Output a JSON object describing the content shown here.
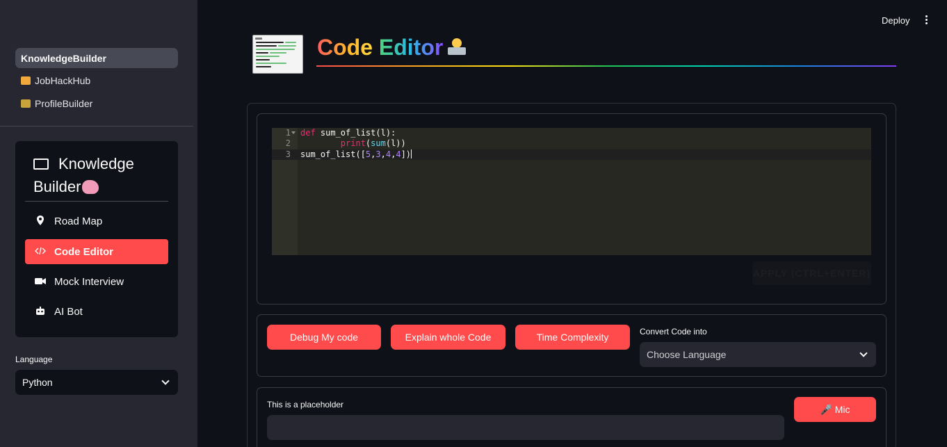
{
  "header": {
    "deploy_label": "Deploy",
    "menu_icon": "kebab-icon"
  },
  "sidebar": {
    "nav": [
      {
        "label": "KnowledgeBuilder",
        "active": true
      },
      {
        "label": "JobHackHub",
        "icon": "briefcase-emoji-icon"
      },
      {
        "label": "ProfileBuilder",
        "icon": "office-worker-emoji-icon"
      }
    ],
    "menu": {
      "title": "Knowledge Builder",
      "items": [
        {
          "label": "Road Map",
          "icon": "map-pin-icon"
        },
        {
          "label": "Code Editor",
          "icon": "code-icon",
          "active": true
        },
        {
          "label": "Mock Interview",
          "icon": "video-camera-icon"
        },
        {
          "label": "AI Bot",
          "icon": "robot-icon"
        }
      ]
    },
    "language": {
      "label": "Language",
      "value": "Python"
    }
  },
  "main": {
    "title_parts": [
      "Code",
      " ",
      "Editor"
    ],
    "editor": {
      "lines": [
        "1",
        "2",
        "3"
      ],
      "apply_label": "APPLY (CTRL+ENTER)"
    },
    "actions": {
      "debug": "Debug My code",
      "explain": "Explain whole Code",
      "complexity": "Time Complexity",
      "convert_label": "Convert Code into",
      "convert_placeholder": "Choose Language"
    },
    "voice": {
      "placeholder_label": "This is a placeholder",
      "mic_label": "🎤 Mic"
    }
  },
  "colors": {
    "accent": "#ff4b4b",
    "sidebar_bg": "#262730",
    "app_bg": "#0e1117",
    "editor_bg": "#272822"
  }
}
